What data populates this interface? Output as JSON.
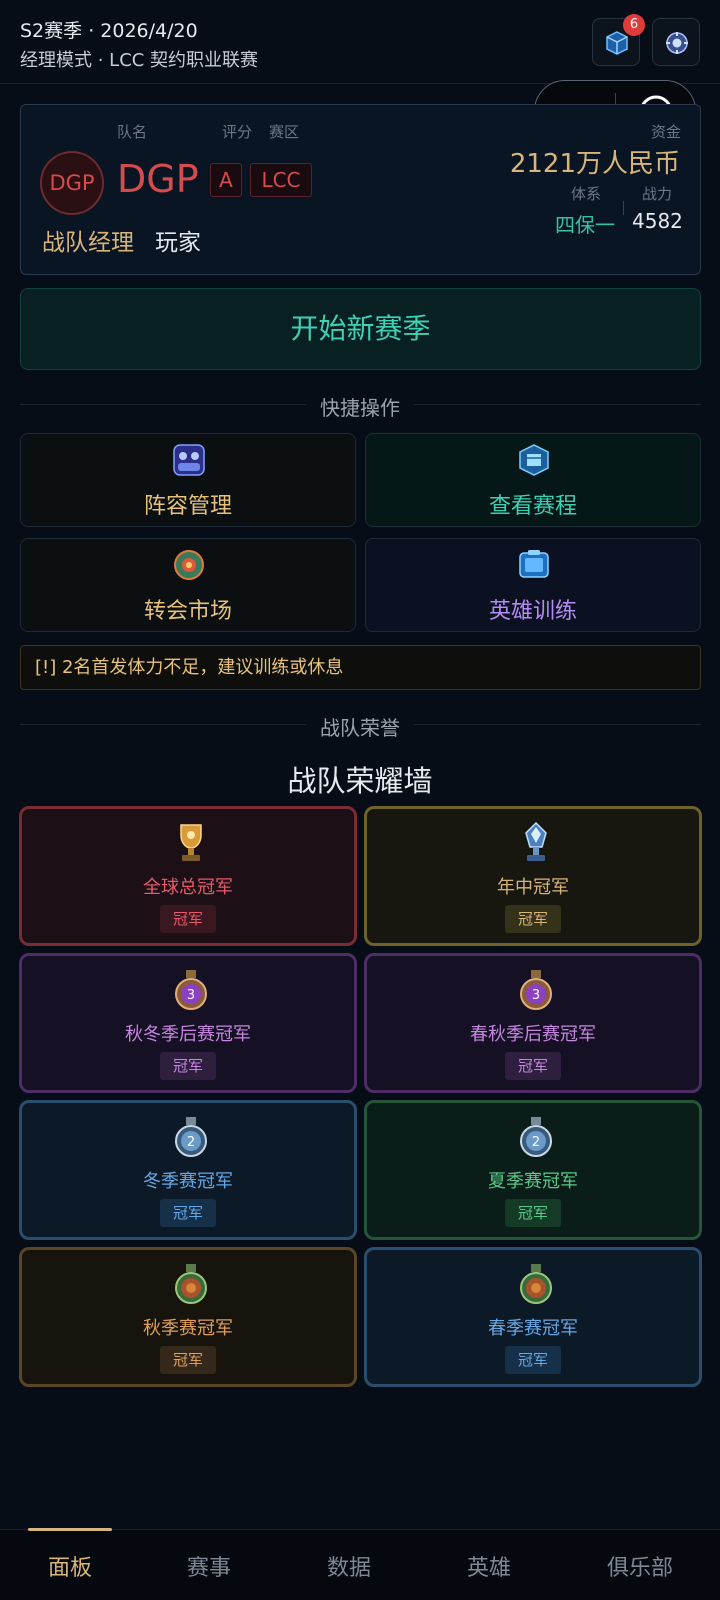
{
  "header": {
    "season_line": "S2赛季 · 2026/4/20",
    "mode_line": "经理模式 · LCC 契约职业联赛",
    "notification_count": "6",
    "icons": [
      "cube-icon",
      "gear-orb-icon",
      "more-dots-icon",
      "record-target-icon"
    ]
  },
  "team_card": {
    "label_name": "队名",
    "label_rating": "评分",
    "label_region": "赛区",
    "label_funds": "资金",
    "logo_text": "DGP",
    "team_name": "DGP",
    "rating": "A",
    "region": "LCC",
    "funds": "2121万人民币",
    "label_system": "体系",
    "label_power": "战力",
    "system": "四保一",
    "power": "4582",
    "manager_label": "战队经理",
    "manager_name": "玩家"
  },
  "start_season": "开始新赛季",
  "quick_section_title": "快捷操作",
  "quick_actions": [
    {
      "label": "阵容管理",
      "icon": "lineup-icon",
      "color": "#e8c27a"
    },
    {
      "label": "查看赛程",
      "icon": "schedule-icon",
      "color": "#3ed1b4"
    },
    {
      "label": "转会市场",
      "icon": "transfer-icon",
      "color": "#e8c27a"
    },
    {
      "label": "英雄训练",
      "icon": "training-icon",
      "color": "#b38cf2"
    }
  ],
  "warning": "[!] 2名首发体力不足，建议训练或休息",
  "honor_section_title": "战队荣誉",
  "honor_wall_title": "战队荣耀墙",
  "honors": [
    {
      "title": "全球总冠军",
      "badge": "冠军",
      "icon": "gold-trophy-icon",
      "accent": "#e5596a"
    },
    {
      "title": "年中冠军",
      "badge": "冠军",
      "icon": "crystal-trophy-icon",
      "accent": "#d8b57a"
    },
    {
      "title": "秋冬季后赛冠军",
      "badge": "冠军",
      "icon": "purple-medal-icon",
      "accent": "#c586e0"
    },
    {
      "title": "春秋季后赛冠军",
      "badge": "冠军",
      "icon": "purple-medal-icon",
      "accent": "#c586e0"
    },
    {
      "title": "冬季赛冠军",
      "badge": "冠军",
      "icon": "silver-medal-icon",
      "accent": "#66a8e6"
    },
    {
      "title": "夏季赛冠军",
      "badge": "冠军",
      "icon": "silver-medal-icon",
      "accent": "#5cc98a"
    },
    {
      "title": "秋季赛冠军",
      "badge": "冠军",
      "icon": "bronze-medal-icon",
      "accent": "#e0a05a"
    },
    {
      "title": "春季赛冠军",
      "badge": "冠军",
      "icon": "bronze-medal-icon",
      "accent": "#66a8e6"
    }
  ],
  "bottom_nav": [
    {
      "label": "面板",
      "active": true
    },
    {
      "label": "赛事",
      "active": false
    },
    {
      "label": "数据",
      "active": false
    },
    {
      "label": "英雄",
      "active": false
    },
    {
      "label": "俱乐部",
      "active": false
    }
  ]
}
